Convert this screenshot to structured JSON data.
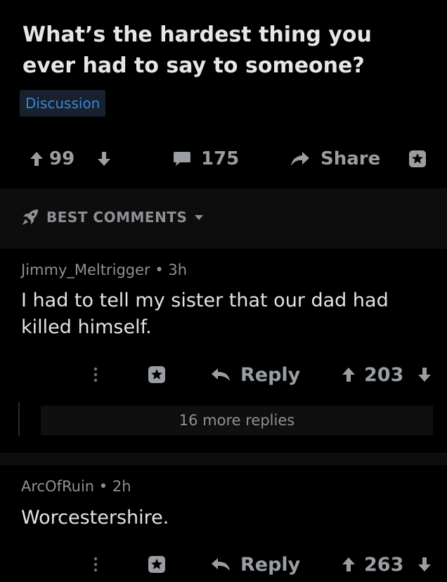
{
  "post": {
    "title": "What’s the hardest thing you ever had to say to someone?",
    "flair": "Discussion",
    "score": "99",
    "comments": "175",
    "share_label": "Share"
  },
  "sort": {
    "label": "BEST COMMENTS"
  },
  "comments": [
    {
      "author": "Jimmy_Meltrigger",
      "age": "3h",
      "meta": "Jimmy_Meltrigger • 3h",
      "body": "I had to tell my sister that our dad had killed himself.",
      "reply_label": "Reply",
      "score": "203",
      "more_replies": "16 more replies"
    },
    {
      "author": "ArcOfRuin",
      "age": "2h",
      "meta": "ArcOfRuin • 2h",
      "body": "Worcestershire.",
      "reply_label": "Reply",
      "score": "263"
    }
  ],
  "colors": {
    "background": "#000000",
    "flair_text": "#3a86d6",
    "flair_bg": "#18212e",
    "muted": "#9a9ea2"
  },
  "icons": [
    "upvote-arrow-icon",
    "downvote-arrow-icon",
    "comment-bubble-icon",
    "share-arrow-icon",
    "award-icon",
    "rocket-icon",
    "caret-down-icon",
    "more-dots-icon",
    "reply-arrow-icon"
  ]
}
